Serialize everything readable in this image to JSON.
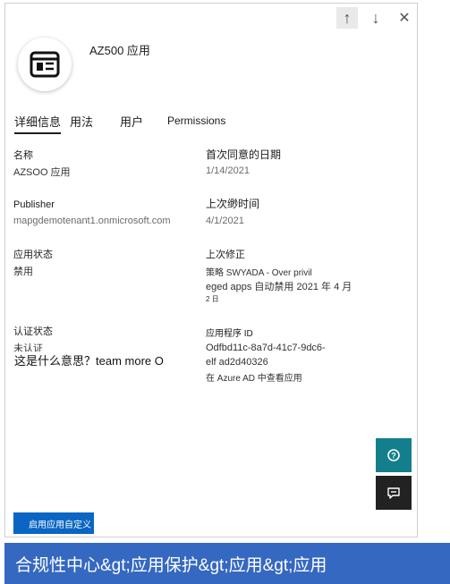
{
  "panel": {
    "app_name": "AZ500 应用",
    "tabs": [
      "详细信息",
      "用法",
      "用户",
      "Permissions"
    ],
    "fields": {
      "name_label": "名称",
      "name_value": "AZSOO 应用",
      "first_consent_label": "首次同意的日期",
      "first_consent_value": "1/14/2021",
      "publisher_label": "Publisher",
      "publisher_value": "mapgdemotenant1.onmicrosoft.com",
      "last_used_label": "上次缈时间",
      "last_used_value": "4/1/2021",
      "app_status_label": "应用状态",
      "app_status_value": "禁用",
      "last_modified_label": "上次修正",
      "last_modified_line1": "策略  SWYADA - Over privil",
      "last_modified_line2": "eged apps 自动禁用 2021 年 4 月",
      "last_modified_line3": "2 日",
      "cert_status_label": "认证状态",
      "cert_status_value": "未认证",
      "app_id_label": "应用程序  ID",
      "app_id_line1": "Odfbd11c-8a7d-41c7-9dc6-",
      "app_id_line2": "elf ad2d40326",
      "view_in_azure": "在 Azure AD 中查看应用"
    },
    "question": "这是什么意思？team more O",
    "enable_button": "启用应用自定义"
  },
  "caption": "合规性中心&gt;应用保护&gt;应用&gt;应用",
  "colors": {
    "help_button": "#137f8c",
    "feedback_button": "#222222",
    "primary_button": "#0a66c2",
    "caption_bg": "#3568c0"
  }
}
